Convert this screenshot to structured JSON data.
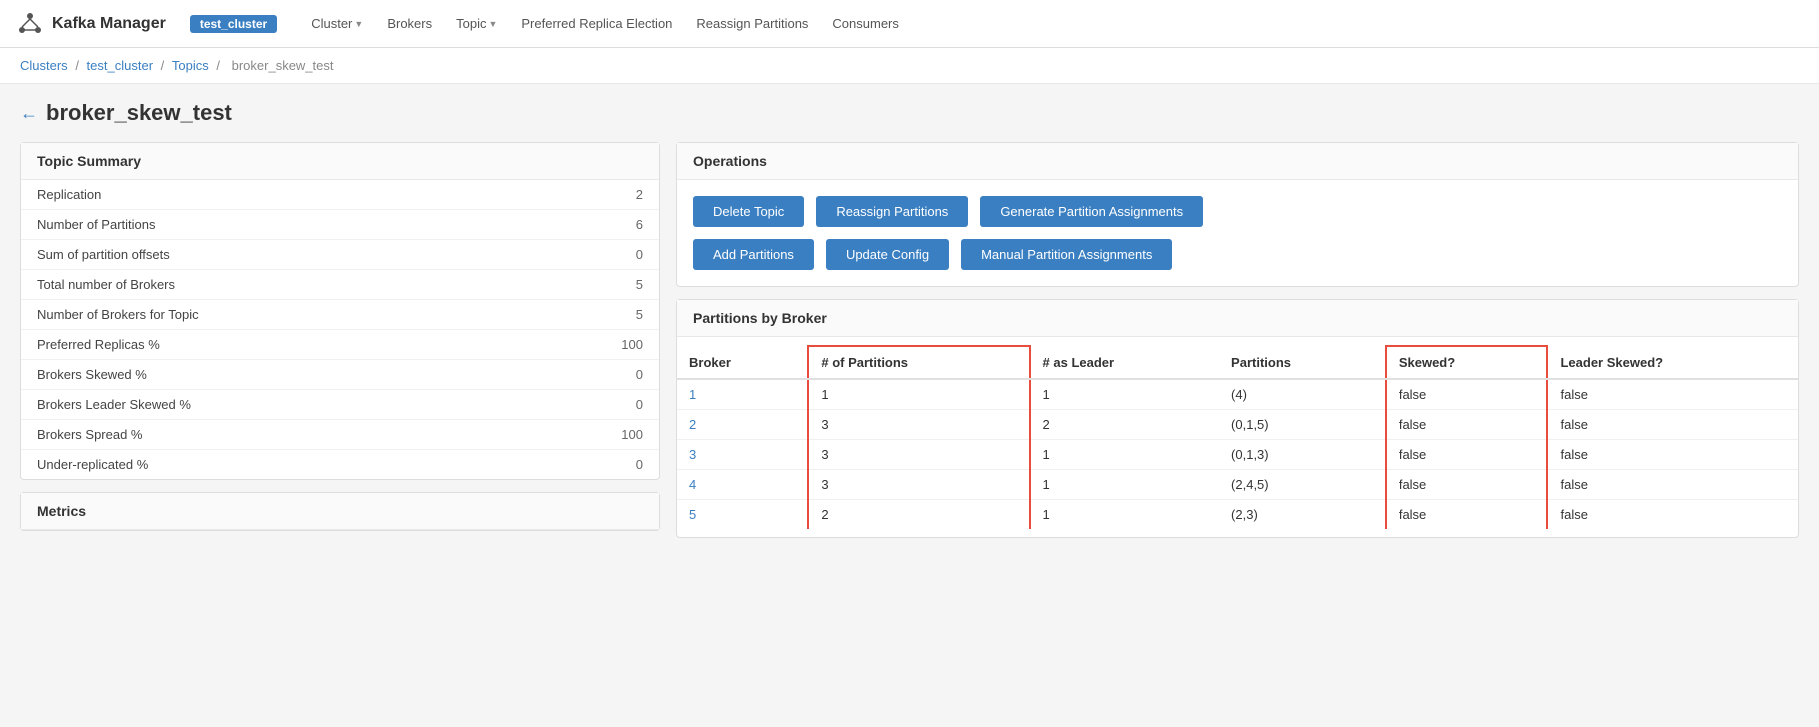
{
  "navbar": {
    "brand": "Kafka Manager",
    "cluster": "test_cluster",
    "links": [
      {
        "label": "Cluster",
        "dropdown": true
      },
      {
        "label": "Brokers",
        "dropdown": false
      },
      {
        "label": "Topic",
        "dropdown": true
      },
      {
        "label": "Preferred Replica Election",
        "dropdown": false
      },
      {
        "label": "Reassign Partitions",
        "dropdown": false
      },
      {
        "label": "Consumers",
        "dropdown": false
      }
    ]
  },
  "breadcrumb": {
    "items": [
      "Clusters",
      "test_cluster",
      "Topics",
      "broker_skew_test"
    ],
    "separators": [
      "/",
      "/",
      "/"
    ]
  },
  "page": {
    "title": "broker_skew_test",
    "back_label": "←"
  },
  "topic_summary": {
    "header": "Topic Summary",
    "rows": [
      {
        "label": "Replication",
        "value": "2"
      },
      {
        "label": "Number of Partitions",
        "value": "6"
      },
      {
        "label": "Sum of partition offsets",
        "value": "0"
      },
      {
        "label": "Total number of Brokers",
        "value": "5"
      },
      {
        "label": "Number of Brokers for Topic",
        "value": "5"
      },
      {
        "label": "Preferred Replicas %",
        "value": "100"
      },
      {
        "label": "Brokers Skewed %",
        "value": "0"
      },
      {
        "label": "Brokers Leader Skewed %",
        "value": "0"
      },
      {
        "label": "Brokers Spread %",
        "value": "100"
      },
      {
        "label": "Under-replicated %",
        "value": "0"
      }
    ]
  },
  "metrics": {
    "header": "Metrics"
  },
  "operations": {
    "header": "Operations",
    "buttons": [
      {
        "label": "Delete Topic",
        "id": "delete-topic"
      },
      {
        "label": "Reassign Partitions",
        "id": "reassign-partitions"
      },
      {
        "label": "Generate Partition Assignments",
        "id": "generate-partition-assignments"
      },
      {
        "label": "Add Partitions",
        "id": "add-partitions"
      },
      {
        "label": "Update Config",
        "id": "update-config"
      },
      {
        "label": "Manual Partition Assignments",
        "id": "manual-partition-assignments"
      }
    ]
  },
  "partitions_by_broker": {
    "header": "Partitions by Broker",
    "columns": [
      "Broker",
      "# of Partitions",
      "# as Leader",
      "Partitions",
      "Skewed?",
      "Leader Skewed?"
    ],
    "rows": [
      {
        "broker": "1",
        "num_partitions": "1",
        "as_leader": "1",
        "partitions": "(4)",
        "skewed": "false",
        "leader_skewed": "false"
      },
      {
        "broker": "2",
        "num_partitions": "3",
        "as_leader": "2",
        "partitions": "(0,1,5)",
        "skewed": "false",
        "leader_skewed": "false"
      },
      {
        "broker": "3",
        "num_partitions": "3",
        "as_leader": "1",
        "partitions": "(0,1,3)",
        "skewed": "false",
        "leader_skewed": "false"
      },
      {
        "broker": "4",
        "num_partitions": "3",
        "as_leader": "1",
        "partitions": "(2,4,5)",
        "skewed": "false",
        "leader_skewed": "false"
      },
      {
        "broker": "5",
        "num_partitions": "2",
        "as_leader": "1",
        "partitions": "(2,3)",
        "skewed": "false",
        "leader_skewed": "false"
      }
    ]
  }
}
